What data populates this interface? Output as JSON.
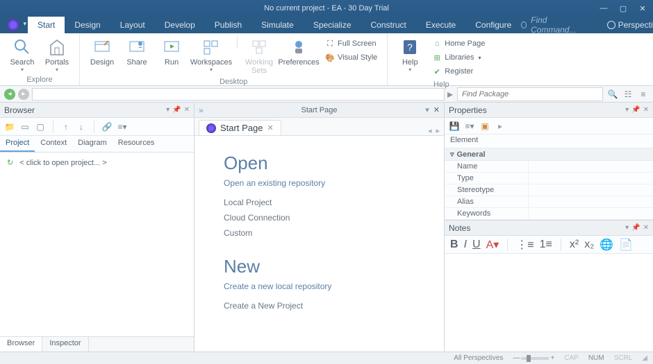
{
  "window": {
    "title": "No current project - EA - 30 Day Trial"
  },
  "menu": {
    "tabs": [
      "Start",
      "Design",
      "Layout",
      "Develop",
      "Publish",
      "Simulate",
      "Specialize",
      "Construct",
      "Execute",
      "Configure"
    ],
    "active": "Start",
    "find_placeholder": "Find Command...",
    "perspective": "Perspective"
  },
  "ribbon": {
    "explore": {
      "label": "Explore",
      "search": "Search",
      "portals": "Portals"
    },
    "desktop": {
      "label": "Desktop",
      "design": "Design",
      "share": "Share",
      "run": "Run",
      "workspaces": "Workspaces",
      "working_sets": "Working Sets",
      "preferences": "Preferences",
      "full_screen": "Full Screen",
      "visual_style": "Visual Style"
    },
    "help": {
      "label": "Help",
      "help": "Help",
      "home_page": "Home Page",
      "libraries": "Libraries",
      "register": "Register"
    }
  },
  "nav": {
    "find_package": "Find Package"
  },
  "browser": {
    "title": "Browser",
    "tabs": [
      "Project",
      "Context",
      "Diagram",
      "Resources"
    ],
    "active_tab": "Project",
    "tree_hint": "< click to open project... >",
    "bottom_tabs": [
      "Browser",
      "Inspector"
    ],
    "bottom_active": "Browser"
  },
  "center": {
    "tabbar_title": "Start Page",
    "doctab": "Start Page",
    "open_h": "Open",
    "open_link": "Open an existing repository",
    "open_items": [
      "Local Project",
      "Cloud Connection",
      "Custom"
    ],
    "new_h": "New",
    "new_link": "Create a new local repository",
    "new_items": [
      "Create a New Project"
    ]
  },
  "properties": {
    "title": "Properties",
    "category": "Element",
    "section": "General",
    "rows": [
      "Name",
      "Type",
      "Stereotype",
      "Alias",
      "Keywords"
    ]
  },
  "notes": {
    "title": "Notes"
  },
  "status": {
    "persp": "All Perspectives",
    "cap": "CAP",
    "num": "NUM",
    "scrl": "SCRL"
  }
}
